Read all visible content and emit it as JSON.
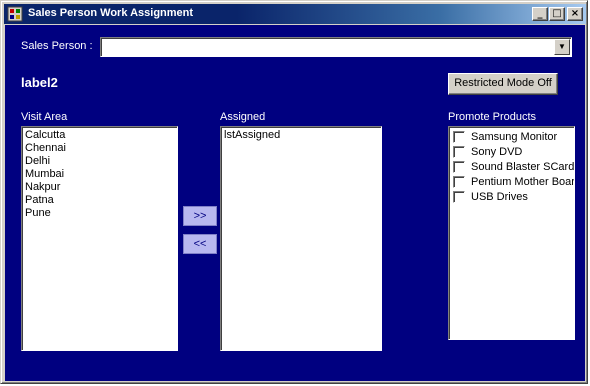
{
  "window": {
    "title": "Sales Person Work Assignment",
    "minimize_glyph": "_",
    "maximize_glyph": "□",
    "close_glyph": "×"
  },
  "form": {
    "sales_person_label": "Sales Person :",
    "sales_person_value": "",
    "combo_arrow_glyph": "▼",
    "status_label": "label2",
    "restricted_mode_button": "Restricted Mode Off",
    "visit_area_label": "Visit Area",
    "assigned_label": "Assigned",
    "promote_products_label": "Promote Products",
    "add_button": ">>",
    "remove_button": "<<"
  },
  "visit_areas": [
    "Calcutta",
    "Chennai",
    "Delhi",
    "Mumbai",
    "Nakpur",
    "Patna",
    "Pune"
  ],
  "assigned": [
    "lstAssigned"
  ],
  "products": [
    {
      "label": "Samsung Monitor",
      "checked": false
    },
    {
      "label": "Sony DVD",
      "checked": false
    },
    {
      "label": "Sound Blaster SCard",
      "checked": false
    },
    {
      "label": "Pentium Mother Board",
      "checked": false
    },
    {
      "label": "USB Drives",
      "checked": false
    }
  ],
  "colors": {
    "client_background": "#000080",
    "titlebar": "#0a246a",
    "face": "#d4d0c8"
  },
  "icons": {
    "app": "app-icon"
  }
}
